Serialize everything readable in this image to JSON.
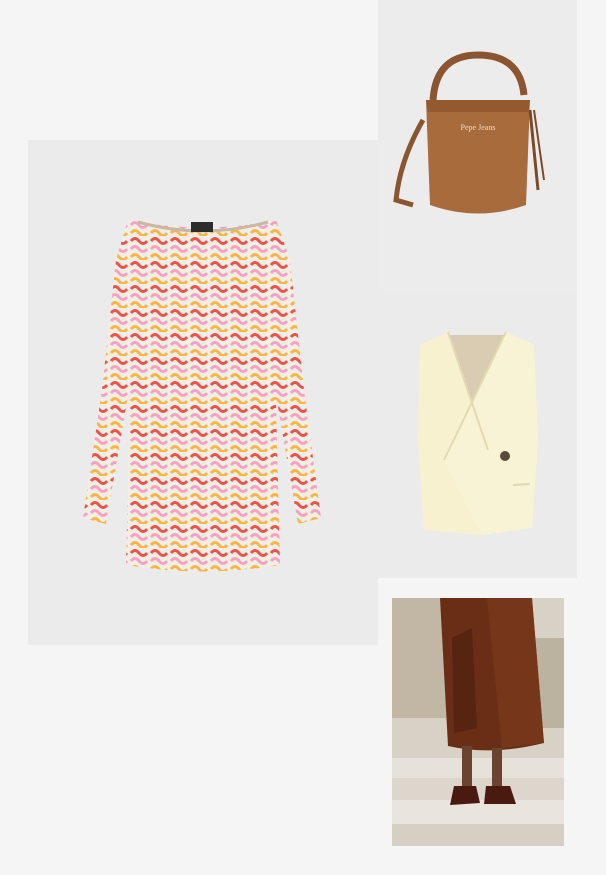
{
  "collage": {
    "background_color": "#f5f5f5",
    "products": [
      {
        "kind": "dress",
        "icon": "knit-mini-dress-icon",
        "colors": [
          "#e8534e",
          "#f4a2c4",
          "#f6b64a",
          "#f3efe6"
        ]
      },
      {
        "kind": "bag",
        "icon": "bucket-bag-icon",
        "colors": [
          "#a86b3c",
          "#8a5530"
        ],
        "logo_text": "Pepe Jeans"
      },
      {
        "kind": "waistcoat",
        "icon": "waistcoat-icon",
        "colors": [
          "#f7f1d0",
          "#5a4c3a"
        ]
      },
      {
        "kind": "sequin-skirt",
        "icon": "sequin-skirt-photo-icon",
        "colors": [
          "#6a2e16",
          "#3a160b",
          "#dcd6cc"
        ]
      }
    ]
  }
}
